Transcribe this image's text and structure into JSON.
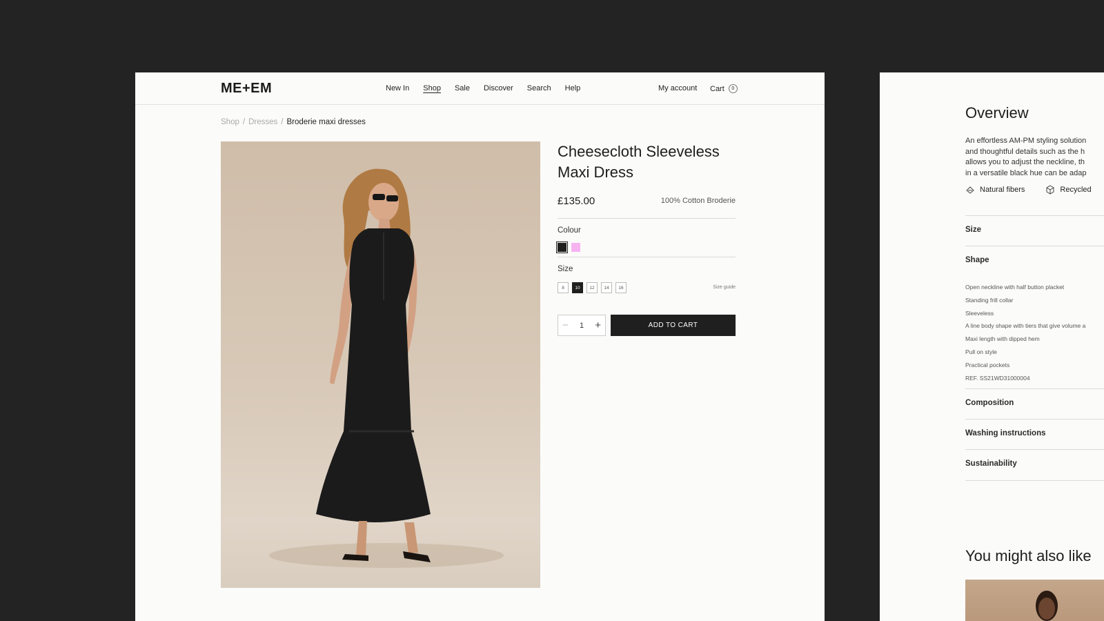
{
  "header": {
    "logo": "ME+EM",
    "nav": [
      "New In",
      "Shop",
      "Sale",
      "Discover",
      "Search",
      "Help"
    ],
    "nav_active": "Shop",
    "account": "My account",
    "cart_label": "Cart",
    "cart_count": "0"
  },
  "breadcrumb": {
    "items": [
      "Shop",
      "Dresses"
    ],
    "current": "Broderie maxi dresses",
    "separator": "/"
  },
  "product": {
    "title_line1": "Cheesecloth Sleeveless",
    "title_line2": "Maxi Dress",
    "price": "£135.00",
    "material": "100% Cotton Broderie",
    "colour_label": "Colour",
    "colours": [
      {
        "name": "black",
        "hex": "#1f1f1f",
        "selected": true
      },
      {
        "name": "pink",
        "hex": "#f7b3f0",
        "selected": false
      }
    ],
    "size_label": "Size",
    "sizes": [
      "8",
      "10",
      "12",
      "14",
      "16"
    ],
    "selected_size": "10",
    "size_guide": "Size guide",
    "quantity": "1",
    "qty_minus": "−",
    "qty_plus": "+",
    "add_to_cart": "ADD TO CART",
    "image_icon": "product-photo-woman-in-black-maxi-dress"
  },
  "details": {
    "overview_heading": "Overview",
    "overview_lines": [
      "An effortless AM-PM styling solution",
      "and thoughtful details such as the h",
      "allows you to adjust the neckline, th",
      "in a versatile black hue can be adap"
    ],
    "badges": [
      {
        "label": "Natural fibers",
        "icon": "leaf-icon"
      },
      {
        "label": "Recycled",
        "icon": "box-icon"
      }
    ],
    "size_heading": "Size",
    "shape_heading": "Shape",
    "shape_items": [
      "Open neckline with half button placket",
      "Standing frill collar",
      "Sleeveless",
      "A line body shape with tiers that give volume a",
      "Maxi length with dipped hem",
      "Pull on style",
      "Practical pockets",
      "REF. SS21WD31000004"
    ],
    "composition_heading": "Composition",
    "washing_heading": "Washing instructions",
    "sustainability_heading": "Sustainability",
    "also_like_heading": "You might also like"
  },
  "colors": {
    "background": "#232323",
    "panel": "#fbfbf9",
    "button_dark": "#1f1f1f",
    "accent_pink": "#f7b3f0"
  }
}
